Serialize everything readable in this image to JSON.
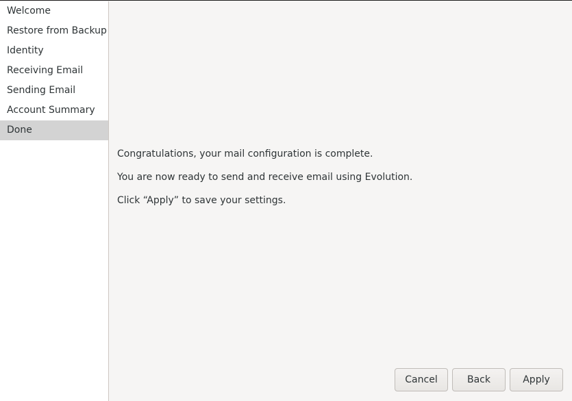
{
  "sidebar": {
    "items": [
      {
        "label": "Welcome"
      },
      {
        "label": "Restore from Backup"
      },
      {
        "label": "Identity"
      },
      {
        "label": "Receiving Email"
      },
      {
        "label": "Sending Email"
      },
      {
        "label": "Account Summary"
      },
      {
        "label": "Done"
      }
    ],
    "selected": "Done"
  },
  "content": {
    "messages": [
      "Congratulations, your mail configuration is complete.",
      "You are now ready to send and receive email using Evolution.",
      "Click “Apply” to save your settings."
    ]
  },
  "buttons": {
    "cancel": "Cancel",
    "back": "Back",
    "apply": "Apply"
  },
  "colors": {
    "background": "#f6f5f4",
    "sidebar_background": "#ffffff",
    "selected_item": "#d3d3d3",
    "text": "#2e3436"
  }
}
